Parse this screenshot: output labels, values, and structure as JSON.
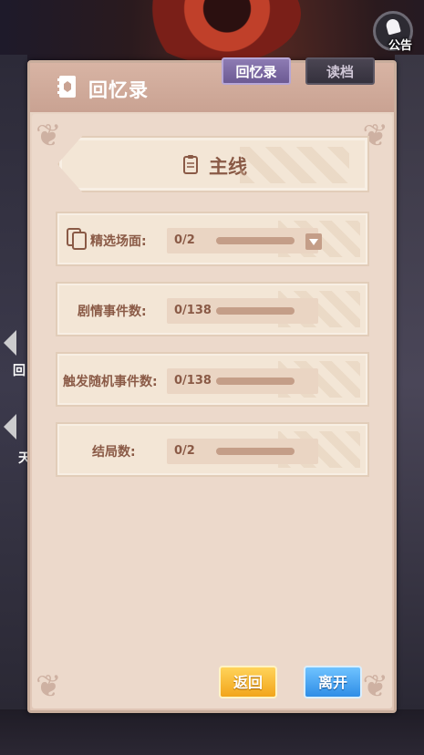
{
  "notice": {
    "label": "公告",
    "icon": "bell-icon"
  },
  "side_tabs": [
    {
      "label": "回"
    },
    {
      "label": "天"
    }
  ],
  "panel": {
    "title": "回忆录",
    "tabs": {
      "memoir": "回忆录",
      "load": "读档"
    }
  },
  "banner": {
    "title": "主线"
  },
  "rows": [
    {
      "label": "精选场面:",
      "value": "0/2",
      "has_dropdown": true
    },
    {
      "label": "剧情事件数:",
      "value": "0/138"
    },
    {
      "label": "触发随机事件数:",
      "value": "0/138"
    },
    {
      "label": "结局数:",
      "value": "0/2"
    }
  ],
  "buttons": {
    "back": "返回",
    "leave": "离开"
  },
  "colors": {
    "accent_purple": "#6c5a93",
    "back_orange": "#f2a51a",
    "leave_blue": "#2e8de6",
    "text_brown": "#8a5a46"
  }
}
